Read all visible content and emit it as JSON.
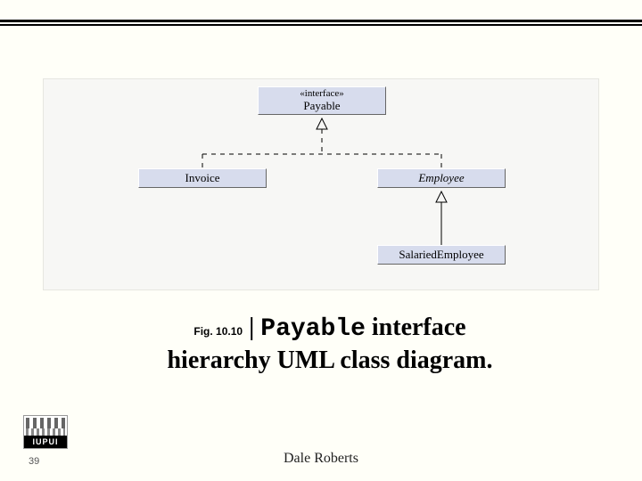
{
  "diagram": {
    "interface_box": {
      "stereo": "«interface»",
      "name": "Payable"
    },
    "invoice_box": {
      "name": "Invoice"
    },
    "employee_box": {
      "name": "Employee"
    },
    "salaried_box": {
      "name": "SalariedEmployee"
    }
  },
  "caption": {
    "figno": "Fig. 10.10",
    "bar": " | ",
    "classname": "Payable",
    "rest1": " interface",
    "line2": "hierarchy UML class diagram."
  },
  "footer": {
    "slide_number": "39",
    "author": "Dale Roberts",
    "logo_text": "IUPUI"
  }
}
